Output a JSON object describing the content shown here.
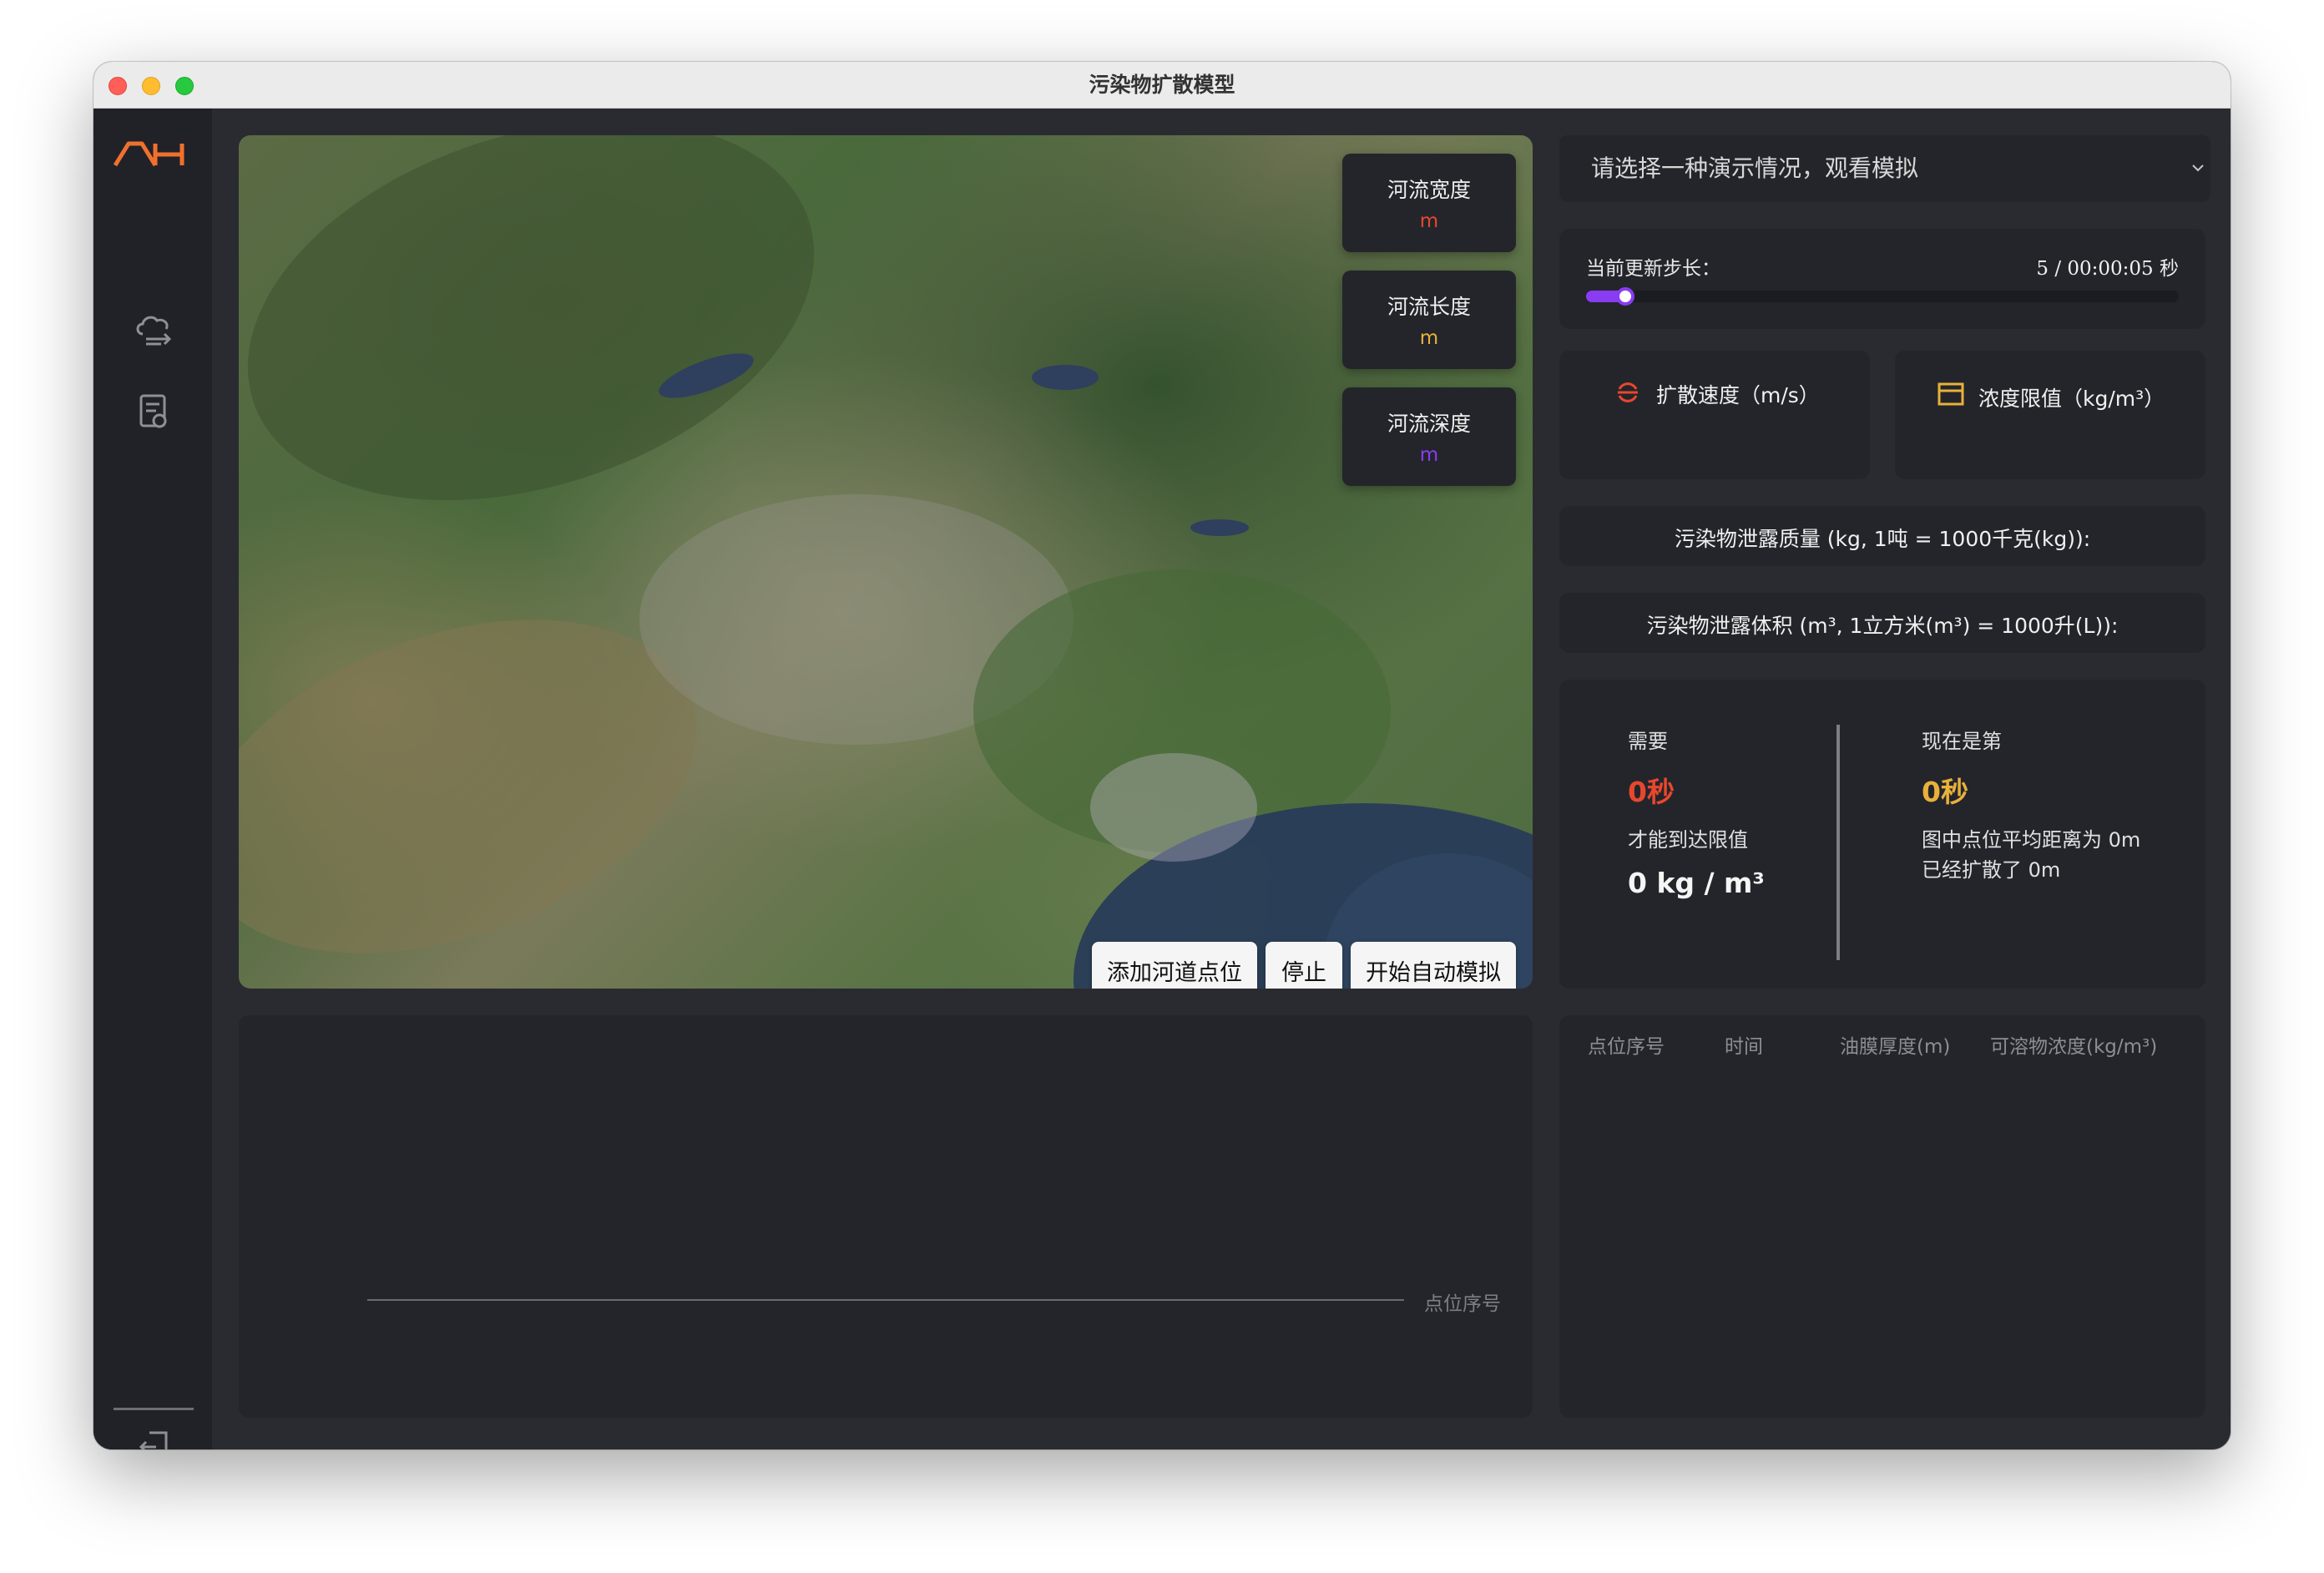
{
  "window": {
    "title": "污染物扩散模型"
  },
  "sidebar": {
    "logo_text": "ΛH"
  },
  "map": {
    "cards": [
      {
        "label": "河流宽度",
        "unit": "m",
        "unit_color": "#e8472e"
      },
      {
        "label": "河流长度",
        "unit": "m",
        "unit_color": "#e8b13a"
      },
      {
        "label": "河流深度",
        "unit": "m",
        "unit_color": "#8a3cf2"
      }
    ],
    "buttons": {
      "add_point": "添加河道点位",
      "stop": "停止",
      "start_auto": "开始自动模拟"
    }
  },
  "scenario_select": {
    "placeholder": "请选择一种演示情况，观看模拟"
  },
  "step": {
    "label": "当前更新步长：",
    "value": "5 / 00:00:05 秒",
    "slider_fraction": 0.045,
    "accent": "#8a3cf2"
  },
  "metrics": {
    "diffusion_speed": "扩散速度（m/s）",
    "concentration_limit": "浓度限值（kg/m³）"
  },
  "inputs": {
    "mass": "污染物泄露质量 (kg, 1吨 = 1000千克(kg)):",
    "volume": "污染物泄露体积 (m³, 1立方米(m³) = 1000升(L)):"
  },
  "result": {
    "need_label": "需要",
    "need_value": "0秒",
    "reach_label": "才能到达限值",
    "reach_value": "0 kg / m³",
    "current_label": "现在是第",
    "current_value": "0秒",
    "avg_distance": "图中点位平均距离为 0m",
    "spread": "已经扩散了 0m",
    "need_color": "#e8472e",
    "current_color": "#e8b13a"
  },
  "chart": {
    "x_label": "点位序号"
  },
  "table": {
    "headers": [
      "点位序号",
      "时间",
      "油膜厚度(m)",
      "可溶物浓度(kg/m³)"
    ]
  }
}
